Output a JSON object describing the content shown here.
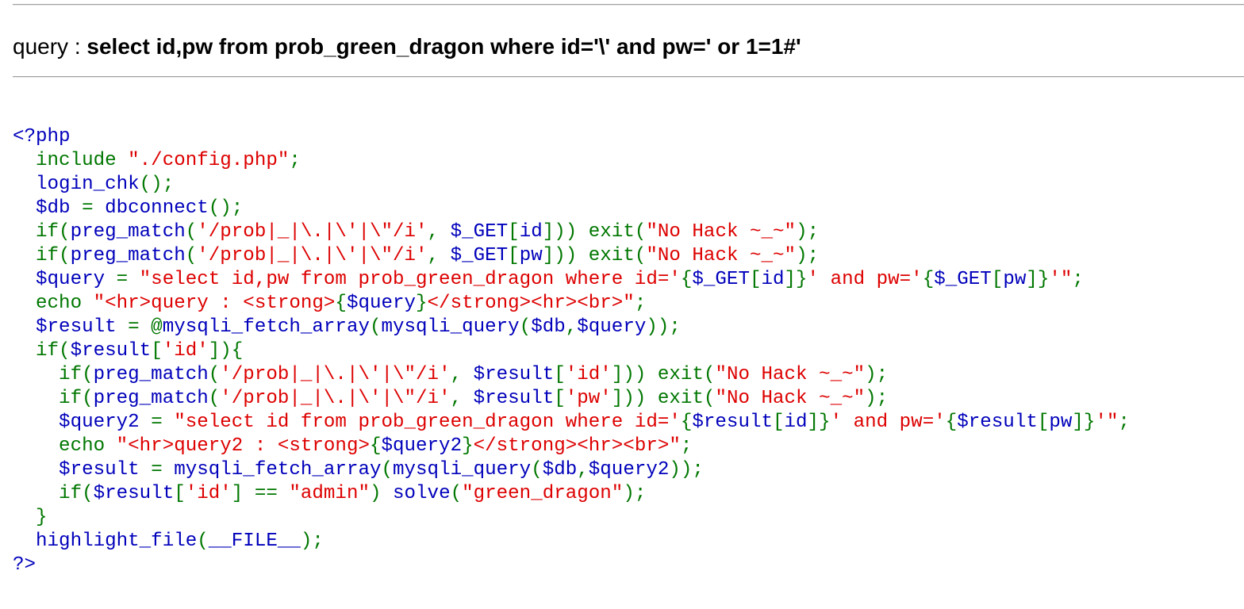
{
  "query_prefix": "query : ",
  "query_value": "select id,pw from prob_green_dragon where id='\\' and pw=' or 1=1#'",
  "code_lines": [
    [
      [
        "h",
        "<?php"
      ]
    ],
    [
      [
        "k",
        "  include "
      ],
      [
        "s",
        "\"./config.php\""
      ],
      [
        "k",
        ";"
      ]
    ],
    [
      [
        "d",
        "  login_chk"
      ],
      [
        "k",
        "();"
      ]
    ],
    [
      [
        "d",
        "  $db "
      ],
      [
        "k",
        "= "
      ],
      [
        "d",
        "dbconnect"
      ],
      [
        "k",
        "();"
      ]
    ],
    [
      [
        "k",
        "  if("
      ],
      [
        "d",
        "preg_match"
      ],
      [
        "k",
        "("
      ],
      [
        "s",
        "'/prob|_|\\.|\\'|\\\"/i'"
      ],
      [
        "k",
        ", "
      ],
      [
        "d",
        "$_GET"
      ],
      [
        "k",
        "["
      ],
      [
        "d",
        "id"
      ],
      [
        "k",
        "])) exit("
      ],
      [
        "s",
        "\"No Hack ~_~\""
      ],
      [
        "k",
        ");"
      ]
    ],
    [
      [
        "k",
        "  if("
      ],
      [
        "d",
        "preg_match"
      ],
      [
        "k",
        "("
      ],
      [
        "s",
        "'/prob|_|\\.|\\'|\\\"/i'"
      ],
      [
        "k",
        ", "
      ],
      [
        "d",
        "$_GET"
      ],
      [
        "k",
        "["
      ],
      [
        "d",
        "pw"
      ],
      [
        "k",
        "])) exit("
      ],
      [
        "s",
        "\"No Hack ~_~\""
      ],
      [
        "k",
        ");"
      ]
    ],
    [
      [
        "d",
        "  $query "
      ],
      [
        "k",
        "= "
      ],
      [
        "s",
        "\"select id,pw from prob_green_dragon where id='"
      ],
      [
        "k",
        "{"
      ],
      [
        "d",
        "$_GET"
      ],
      [
        "k",
        "["
      ],
      [
        "d",
        "id"
      ],
      [
        "k",
        "]}"
      ],
      [
        "s",
        "' and pw='"
      ],
      [
        "k",
        "{"
      ],
      [
        "d",
        "$_GET"
      ],
      [
        "k",
        "["
      ],
      [
        "d",
        "pw"
      ],
      [
        "k",
        "]}"
      ],
      [
        "s",
        "'\""
      ],
      [
        "k",
        ";"
      ]
    ],
    [
      [
        "k",
        "  echo "
      ],
      [
        "s",
        "\"<hr>query : <strong>"
      ],
      [
        "k",
        "{"
      ],
      [
        "d",
        "$query"
      ],
      [
        "k",
        "}"
      ],
      [
        "s",
        "</strong><hr><br>\""
      ],
      [
        "k",
        ";"
      ]
    ],
    [
      [
        "d",
        "  $result "
      ],
      [
        "k",
        "= @"
      ],
      [
        "d",
        "mysqli_fetch_array"
      ],
      [
        "k",
        "("
      ],
      [
        "d",
        "mysqli_query"
      ],
      [
        "k",
        "("
      ],
      [
        "d",
        "$db"
      ],
      [
        "k",
        ","
      ],
      [
        "d",
        "$query"
      ],
      [
        "k",
        "));"
      ]
    ],
    [
      [
        "k",
        "  if("
      ],
      [
        "d",
        "$result"
      ],
      [
        "k",
        "["
      ],
      [
        "s",
        "'id'"
      ],
      [
        "k",
        "]){"
      ]
    ],
    [
      [
        "k",
        "    if("
      ],
      [
        "d",
        "preg_match"
      ],
      [
        "k",
        "("
      ],
      [
        "s",
        "'/prob|_|\\.|\\'|\\\"/i'"
      ],
      [
        "k",
        ", "
      ],
      [
        "d",
        "$result"
      ],
      [
        "k",
        "["
      ],
      [
        "s",
        "'id'"
      ],
      [
        "k",
        "])) exit("
      ],
      [
        "s",
        "\"No Hack ~_~\""
      ],
      [
        "k",
        ");"
      ]
    ],
    [
      [
        "k",
        "    if("
      ],
      [
        "d",
        "preg_match"
      ],
      [
        "k",
        "("
      ],
      [
        "s",
        "'/prob|_|\\.|\\'|\\\"/i'"
      ],
      [
        "k",
        ", "
      ],
      [
        "d",
        "$result"
      ],
      [
        "k",
        "["
      ],
      [
        "s",
        "'pw'"
      ],
      [
        "k",
        "])) exit("
      ],
      [
        "s",
        "\"No Hack ~_~\""
      ],
      [
        "k",
        ");"
      ]
    ],
    [
      [
        "d",
        "    $query2 "
      ],
      [
        "k",
        "= "
      ],
      [
        "s",
        "\"select id from prob_green_dragon where id='"
      ],
      [
        "k",
        "{"
      ],
      [
        "d",
        "$result"
      ],
      [
        "k",
        "["
      ],
      [
        "d",
        "id"
      ],
      [
        "k",
        "]}"
      ],
      [
        "s",
        "' and pw='"
      ],
      [
        "k",
        "{"
      ],
      [
        "d",
        "$result"
      ],
      [
        "k",
        "["
      ],
      [
        "d",
        "pw"
      ],
      [
        "k",
        "]}"
      ],
      [
        "s",
        "'\""
      ],
      [
        "k",
        ";"
      ]
    ],
    [
      [
        "k",
        "    echo "
      ],
      [
        "s",
        "\"<hr>query2 : <strong>"
      ],
      [
        "k",
        "{"
      ],
      [
        "d",
        "$query2"
      ],
      [
        "k",
        "}"
      ],
      [
        "s",
        "</strong><hr><br>\""
      ],
      [
        "k",
        ";"
      ]
    ],
    [
      [
        "d",
        "    $result "
      ],
      [
        "k",
        "= "
      ],
      [
        "d",
        "mysqli_fetch_array"
      ],
      [
        "k",
        "("
      ],
      [
        "d",
        "mysqli_query"
      ],
      [
        "k",
        "("
      ],
      [
        "d",
        "$db"
      ],
      [
        "k",
        ","
      ],
      [
        "d",
        "$query2"
      ],
      [
        "k",
        "));"
      ]
    ],
    [
      [
        "k",
        "    if("
      ],
      [
        "d",
        "$result"
      ],
      [
        "k",
        "["
      ],
      [
        "s",
        "'id'"
      ],
      [
        "k",
        "] == "
      ],
      [
        "s",
        "\"admin\""
      ],
      [
        "k",
        ") "
      ],
      [
        "d",
        "solve"
      ],
      [
        "k",
        "("
      ],
      [
        "s",
        "\"green_dragon\""
      ],
      [
        "k",
        ");"
      ]
    ],
    [
      [
        "k",
        "  }"
      ]
    ],
    [
      [
        "d",
        "  highlight_file"
      ],
      [
        "k",
        "("
      ],
      [
        "d",
        "__FILE__"
      ],
      [
        "k",
        ");"
      ]
    ],
    [
      [
        "h",
        "?>"
      ]
    ]
  ]
}
